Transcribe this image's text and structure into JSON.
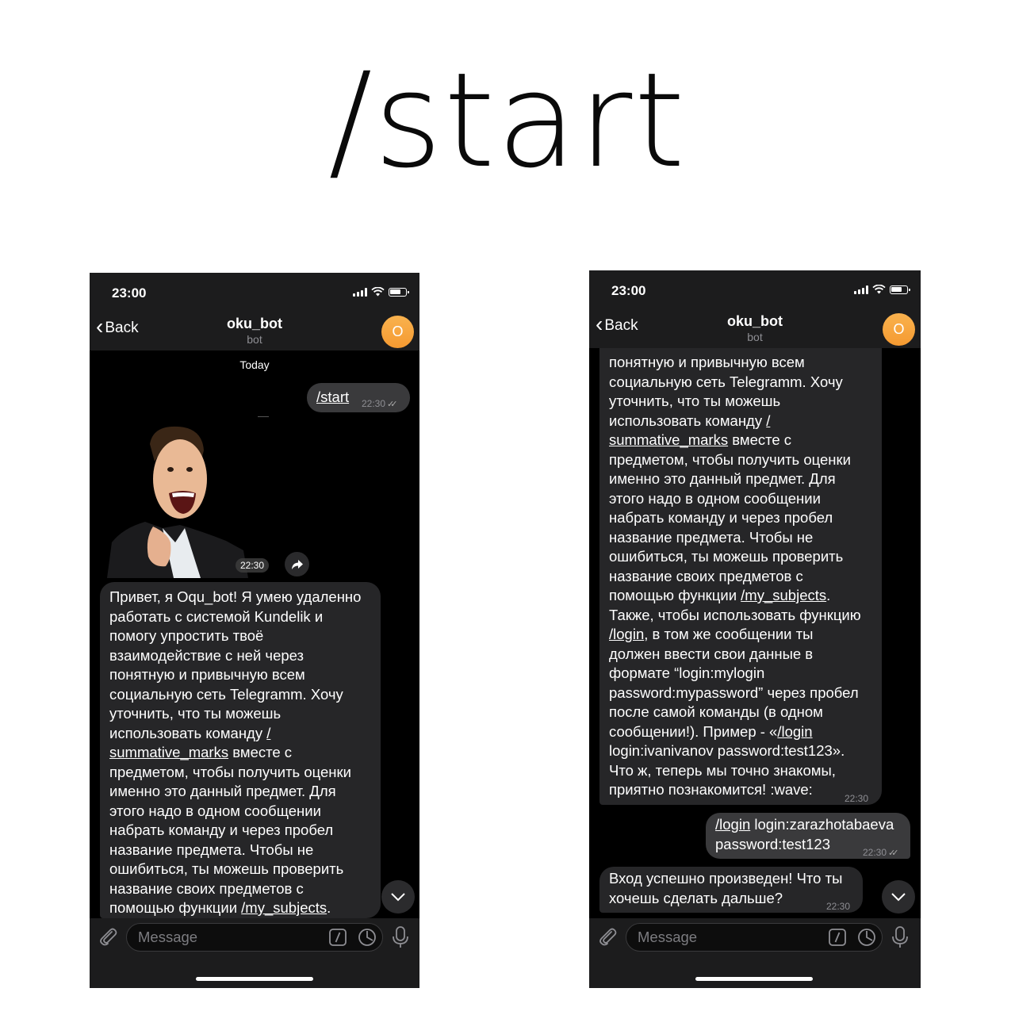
{
  "headline": "/start",
  "left_phone": {
    "status_time": "23:00",
    "back_label": "Back",
    "chat_title": "oku_bot",
    "chat_subtitle": "bot",
    "avatar_letter": "O",
    "date_label": "Today",
    "start_command": "/start",
    "start_time": "22:30",
    "sticker_time": "22:30",
    "intro_message": {
      "part1": "Привет, я Oqu_bot! Я умею удаленно\nработать с системой Kundelik и\nпомогу упростить твоё\nвзаимодействие с ней через\nпонятную и привычную всем\nсоциальную сеть Telegramm. Хочу\nуточнить, что ты можешь\nиспользовать команду ",
      "cmd1": "/\nsummative_marks",
      "part2": " вместе с\nпредметом, чтобы получить оценки\nименно это данный предмет. Для\nэтого надо в одном сообщении\nнабрать команду и через пробел\nназвание предмета. Чтобы не\nошибиться, ты можешь проверить\nназвание своих предметов с\nпомощью функции ",
      "cmd2": "/my_subjects",
      "part3": "."
    },
    "input_placeholder": "Message"
  },
  "right_phone": {
    "status_time": "23:00",
    "back_label": "Back",
    "chat_title": "oku_bot",
    "chat_subtitle": "bot",
    "avatar_letter": "O",
    "intro_message": {
      "part1": "понятную и привычную всем\nсоциальную сеть Telegramm. Хочу\nуточнить, что ты можешь\nиспользовать команду ",
      "cmd1": "/\nsummative_marks",
      "part2": " вместе с\nпредметом, чтобы получить оценки\nименно это данный предмет. Для\nэтого надо в одном сообщении\nнабрать команду и через пробел\nназвание предмета. Чтобы не\nошибиться, ты можешь проверить\nназвание своих предметов с\nпомощью функции ",
      "cmd2": "/my_subjects",
      "part3": ".\nТакже, чтобы использовать функцию\n",
      "cmd3": "/login",
      "part4": ", в том же сообщении ты\nдолжен ввести свои данные в\nформате “login:mylogin\npassword:mypassword” через пробел\nпосле самой команды (в одном\nсообщении!). Пример - «",
      "cmd4": "/login",
      "part5": "\nlogin:ivanivanov password:test123».\nЧто ж, теперь мы точно знакомы,\nприятно познакомится! :wave:",
      "time": "22:30"
    },
    "login_message": {
      "cmd": "/login",
      "rest": " login:zarazhotabaeva\npassword:test123",
      "time": "22:30"
    },
    "success_message": {
      "text": "Вход успешно произведен! Что ты\nхочешь сделать дальше?",
      "time": "22:30"
    },
    "input_placeholder": "Message"
  },
  "colors": {
    "background": "#ffffff",
    "phone_bg": "#000000",
    "header_bg": "#1c1c1d",
    "incoming_bubble": "#262628",
    "outgoing_bubble": "#3a3a3c",
    "avatar": "#f7a33b"
  },
  "icons": [
    "chevron-left-icon",
    "signal-icon",
    "wifi-icon",
    "battery-icon",
    "share-icon",
    "chevron-down-icon",
    "paperclip-icon",
    "slash-command-icon",
    "clock-icon",
    "mic-icon"
  ]
}
